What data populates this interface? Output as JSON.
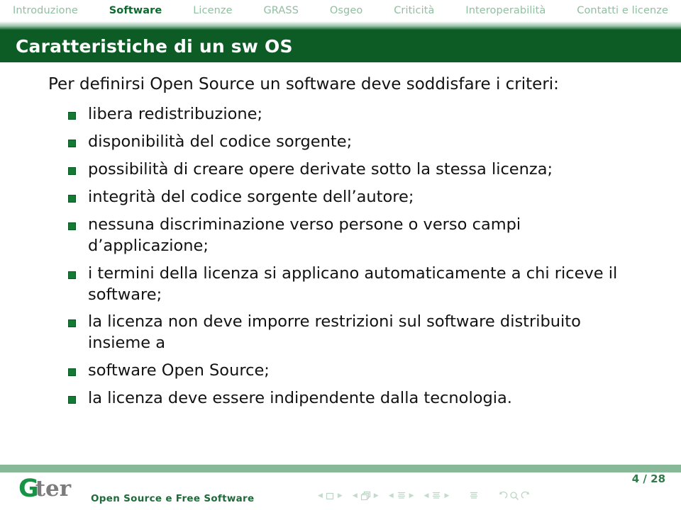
{
  "navbar": {
    "items": [
      {
        "label": "Introduzione",
        "active": false
      },
      {
        "label": "Software",
        "active": true
      },
      {
        "label": "Licenze",
        "active": false
      },
      {
        "label": "GRASS",
        "active": false
      },
      {
        "label": "Osgeo",
        "active": false
      },
      {
        "label": "Criticità",
        "active": false
      },
      {
        "label": "Interoperabilità",
        "active": false
      },
      {
        "label": "Contatti e licenze",
        "active": false
      }
    ],
    "colors": {
      "inactive": "#8fbfa0",
      "active": "#0b6b2e"
    }
  },
  "title": {
    "text": "Caratteristiche di un sw OS",
    "background": "#0d5c26",
    "color": "#ffffff"
  },
  "content": {
    "lead": "Per definirsi Open Source un software deve soddisfare i criteri:",
    "bullet_color": "#137a33",
    "items": [
      "libera redistribuzione;",
      "disponibilità del codice sorgente;",
      "possibilità di creare opere derivate sotto la stessa licenza;",
      "integrità del codice sorgente dell’autore;",
      "nessuna discriminazione verso persone o verso campi d’applicazione;",
      "i termini della licenza si applicano automaticamente a chi riceve il software;",
      "la licenza non deve imporre restrizioni sul software distribuito insieme a",
      "software Open Source;",
      "la licenza deve essere indipendente dalla tecnologia."
    ]
  },
  "footer": {
    "logo": {
      "mark": "G",
      "rest": "ter",
      "mark_color": "#189245",
      "rest_color": "#7c7c7c"
    },
    "subtitle": "Open Source e Free Software",
    "page": "4 / 28",
    "separator_color": "#87b897",
    "nav_symbols": [
      {
        "name": "slide-prev",
        "glyph": "◀"
      },
      {
        "name": "slide-current-icon",
        "glyph": "▢"
      },
      {
        "name": "slide-next",
        "glyph": "▶"
      },
      {
        "name": "frame-prev",
        "glyph": "◀"
      },
      {
        "name": "frame-current-icon",
        "glyph": "❐"
      },
      {
        "name": "frame-next",
        "glyph": "▶"
      },
      {
        "name": "subsection-prev",
        "glyph": "◀"
      },
      {
        "name": "subsection-current-icon",
        "glyph": "≡"
      },
      {
        "name": "subsection-next",
        "glyph": "▶"
      },
      {
        "name": "section-prev",
        "glyph": "◀"
      },
      {
        "name": "section-current-icon",
        "glyph": "≡"
      },
      {
        "name": "section-next",
        "glyph": "▶"
      },
      {
        "name": "presentation-icon",
        "glyph": "≡"
      },
      {
        "name": "back-icon",
        "glyph": "↺"
      },
      {
        "name": "search-icon",
        "glyph": "🔍"
      },
      {
        "name": "forward-icon",
        "glyph": "↻"
      }
    ]
  }
}
